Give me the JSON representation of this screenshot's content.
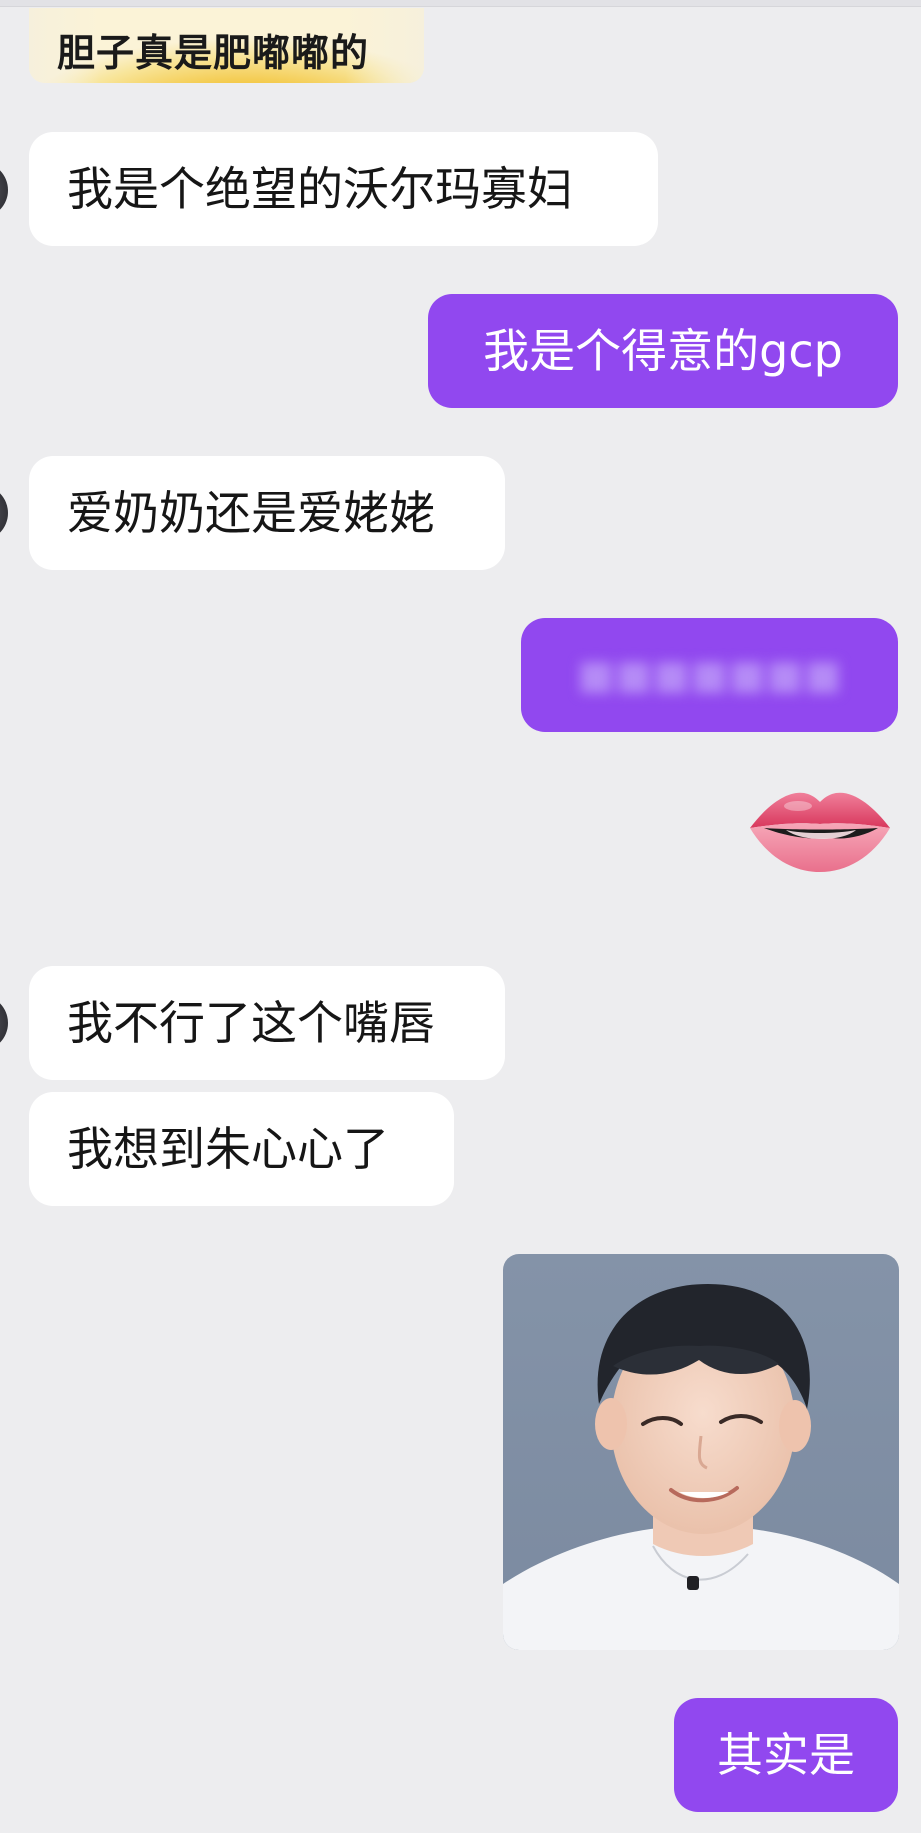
{
  "sticker": {
    "caption": "胆子真是肥嘟嘟的",
    "image_icon": "yellow-sticker-image"
  },
  "messages": [
    {
      "side": "in",
      "text": "我是个绝望的沃尔玛寡妇"
    },
    {
      "side": "out",
      "text": "我是个得意的gcp"
    },
    {
      "side": "in",
      "text": "爱奶奶还是爱姥姥"
    },
    {
      "side": "out",
      "text": "",
      "blurred": true
    },
    {
      "side": "out",
      "emoji": "biting-lip-emoji"
    },
    {
      "side": "in",
      "text": "我不行了这个嘴唇"
    },
    {
      "side": "in",
      "text": "我想到朱心心了"
    },
    {
      "side": "out",
      "image": "photo-boy-smiling"
    },
    {
      "side": "out",
      "text": "其实是"
    }
  ],
  "colors": {
    "background": "#ededef",
    "incoming_bubble": "#ffffff",
    "outgoing_bubble": "#9148ef",
    "incoming_text": "#161616",
    "outgoing_text": "#ffffff"
  }
}
